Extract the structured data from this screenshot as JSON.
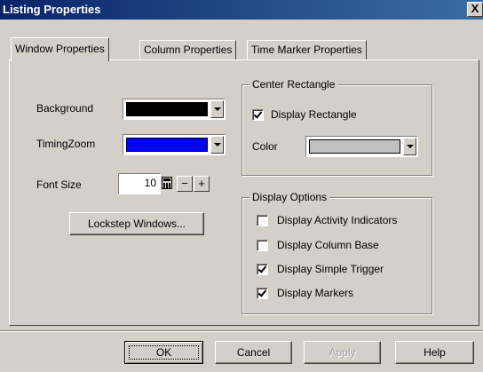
{
  "window": {
    "title": "Listing Properties",
    "close_label": "X"
  },
  "tabs": [
    {
      "label": "Window Properties",
      "active": true
    },
    {
      "label": "Column Properties",
      "active": false
    },
    {
      "label": "Time Marker Properties",
      "active": false
    }
  ],
  "window_props": {
    "background": {
      "label": "Background",
      "color": "#000000"
    },
    "timingzoom": {
      "label": "TimingZoom",
      "color": "#0000ff"
    },
    "font_size": {
      "label": "Font Size",
      "value": "10",
      "minus": "−",
      "plus": "+"
    },
    "lockstep_label": "Lockstep Windows..."
  },
  "center_rectangle": {
    "title": "Center Rectangle",
    "display_rectangle": {
      "label": "Display Rectangle",
      "checked": true
    },
    "color": {
      "label": "Color",
      "value": "#c0c0c0"
    }
  },
  "display_options": {
    "title": "Display Options",
    "items": [
      {
        "label": "Display Activity Indicators",
        "checked": false
      },
      {
        "label": "Display Column Base",
        "checked": false
      },
      {
        "label": "Display Simple Trigger",
        "checked": true
      },
      {
        "label": "Display Markers",
        "checked": true
      }
    ]
  },
  "buttons": {
    "ok": "OK",
    "cancel": "Cancel",
    "apply": "Apply",
    "help": "Help"
  }
}
